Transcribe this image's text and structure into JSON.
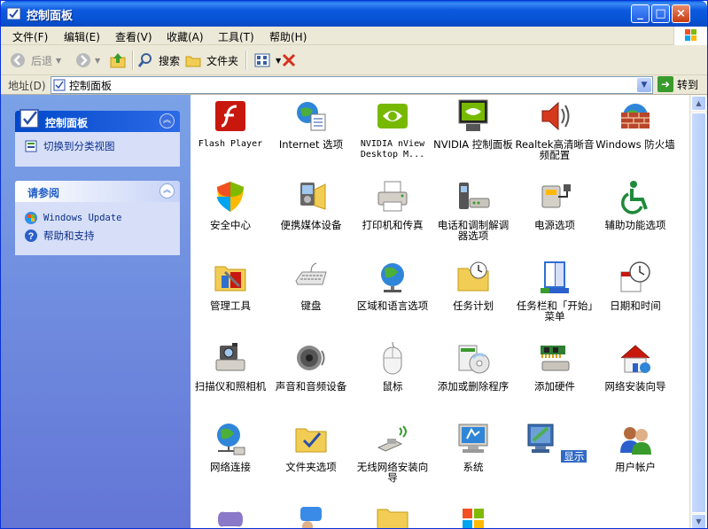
{
  "window": {
    "title": "控制面板"
  },
  "menu": [
    "文件(F)",
    "编辑(E)",
    "查看(V)",
    "收藏(A)",
    "工具(T)",
    "帮助(H)"
  ],
  "toolbar": {
    "back": "后退",
    "search": "搜索",
    "folders": "文件夹"
  },
  "address": {
    "label": "地址(D)",
    "value": "控制面板",
    "go": "转到"
  },
  "sidebar": {
    "panel1": {
      "title": "控制面板",
      "link": "切换到分类视图"
    },
    "panel2": {
      "title": "请参阅",
      "links": [
        "Windows Update",
        "帮助和支持"
      ]
    }
  },
  "items": [
    {
      "label": "Flash Player",
      "icon": "flash-icon"
    },
    {
      "label": "Internet 选项",
      "icon": "internet-options-icon"
    },
    {
      "label": "NVIDIA nView Desktop M...",
      "icon": "nvidia-nview-icon"
    },
    {
      "label": "NVIDIA 控制面板",
      "icon": "nvidia-control-icon"
    },
    {
      "label": "Realtek高清晰音频配置",
      "icon": "realtek-audio-icon"
    },
    {
      "label": "Windows 防火墙",
      "icon": "firewall-icon"
    },
    {
      "label": "安全中心",
      "icon": "security-center-icon"
    },
    {
      "label": "便携媒体设备",
      "icon": "portable-media-icon"
    },
    {
      "label": "打印机和传真",
      "icon": "printer-icon"
    },
    {
      "label": "电话和调制解调器选项",
      "icon": "phone-modem-icon"
    },
    {
      "label": "电源选项",
      "icon": "power-options-icon"
    },
    {
      "label": "辅助功能选项",
      "icon": "accessibility-icon"
    },
    {
      "label": "管理工具",
      "icon": "admin-tools-icon"
    },
    {
      "label": "键盘",
      "icon": "keyboard-icon"
    },
    {
      "label": "区域和语言选项",
      "icon": "region-language-icon"
    },
    {
      "label": "任务计划",
      "icon": "scheduled-tasks-icon"
    },
    {
      "label": "任务栏和「开始」菜单",
      "icon": "taskbar-start-icon"
    },
    {
      "label": "日期和时间",
      "icon": "date-time-icon"
    },
    {
      "label": "扫描仪和照相机",
      "icon": "scanner-camera-icon"
    },
    {
      "label": "声音和音频设备",
      "icon": "sound-icon"
    },
    {
      "label": "鼠标",
      "icon": "mouse-icon"
    },
    {
      "label": "添加或删除程序",
      "icon": "add-remove-programs-icon"
    },
    {
      "label": "添加硬件",
      "icon": "add-hardware-icon"
    },
    {
      "label": "网络安装向导",
      "icon": "network-setup-icon"
    },
    {
      "label": "网络连接",
      "icon": "network-connections-icon"
    },
    {
      "label": "文件夹选项",
      "icon": "folder-options-icon"
    },
    {
      "label": "无线网络安装向导",
      "icon": "wireless-setup-icon"
    },
    {
      "label": "系统",
      "icon": "system-icon"
    },
    {
      "label": "显示",
      "icon": "display-icon"
    },
    {
      "label": "用户帐户",
      "icon": "user-accounts-icon"
    }
  ]
}
